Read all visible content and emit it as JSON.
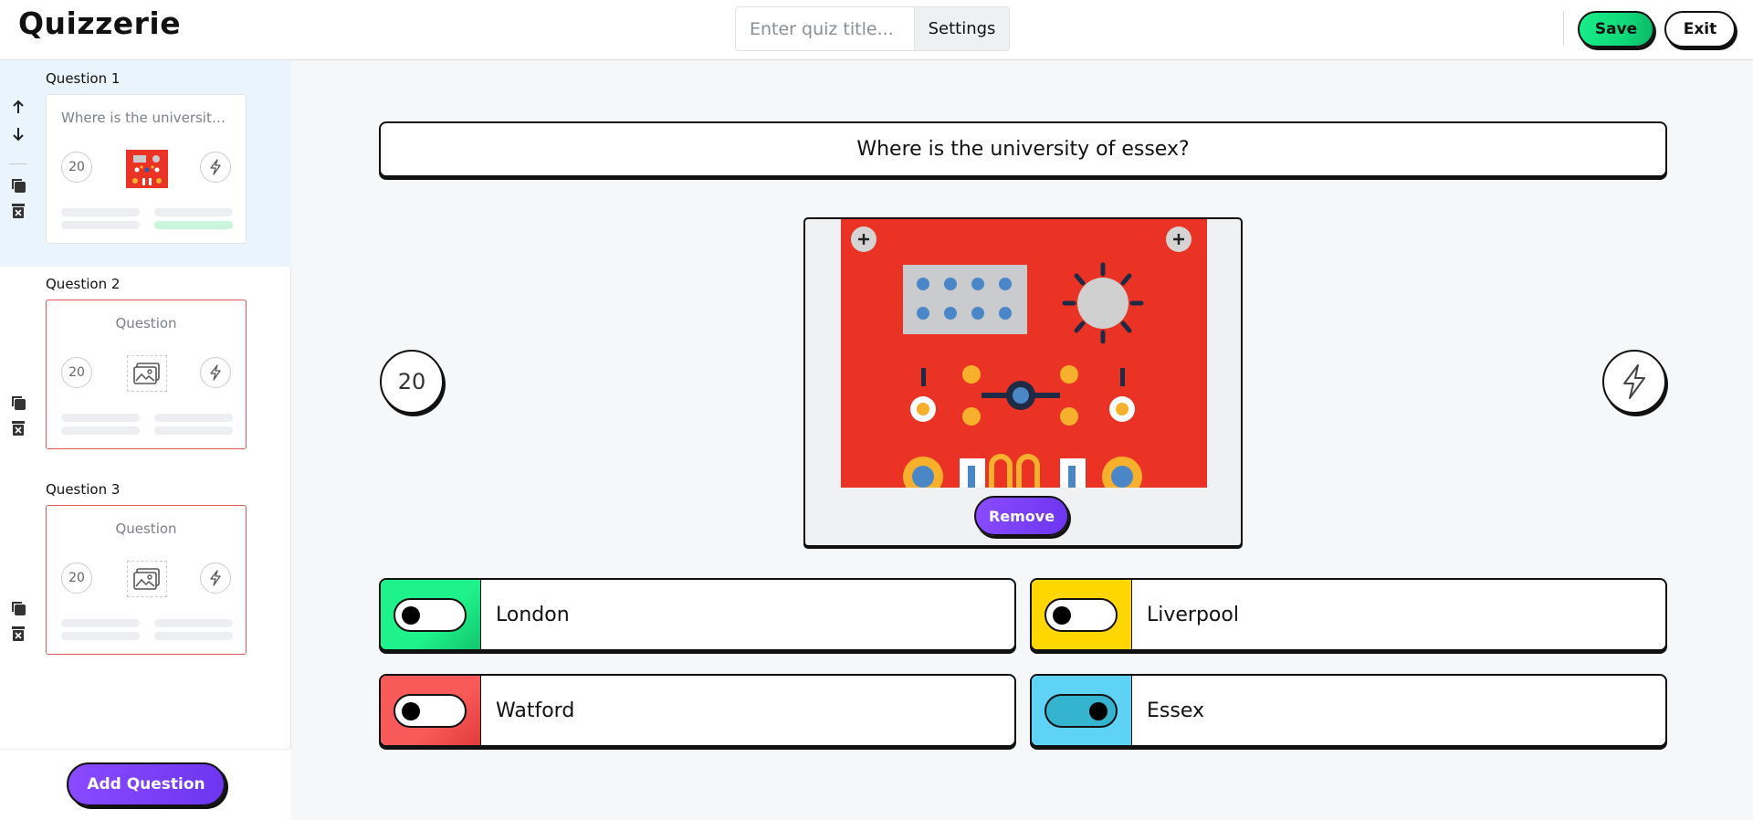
{
  "app": {
    "logo": "Quizzerie"
  },
  "header": {
    "title_placeholder": "Enter quiz title...",
    "settings_label": "Settings",
    "save_label": "Save",
    "exit_label": "Exit"
  },
  "sidebar": {
    "slides": [
      {
        "label": "Question 1",
        "question_preview": "Where is the university ...",
        "time": "20",
        "has_image": true,
        "active": true,
        "answers_preview": [
          "incorrect",
          "correct"
        ]
      },
      {
        "label": "Question 2",
        "question_preview": "Question",
        "time": "20",
        "has_image": false,
        "active": false,
        "error": true
      },
      {
        "label": "Question 3",
        "question_preview": "Question",
        "time": "20",
        "has_image": false,
        "active": false,
        "error": true
      }
    ],
    "add_question_label": "Add Question"
  },
  "editor": {
    "question": "Where is the university of essex?",
    "time_limit": "20",
    "media": {
      "icon": "circuit-board-image",
      "remove_label": "Remove"
    },
    "answers": [
      {
        "text": "London",
        "color": "#1ef28a",
        "correct": false
      },
      {
        "text": "Liverpool",
        "color": "#ffd600",
        "correct": false
      },
      {
        "text": "Watford",
        "color": "#f24f4f",
        "correct": false
      },
      {
        "text": "Essex",
        "color": "#5fd3f5",
        "correct": true
      }
    ]
  },
  "colors": {
    "accent_purple": "#6d35f0",
    "save_green": "#10d97a",
    "active_slide_bg": "#eaf4fd",
    "error_border": "#e05a5a"
  }
}
